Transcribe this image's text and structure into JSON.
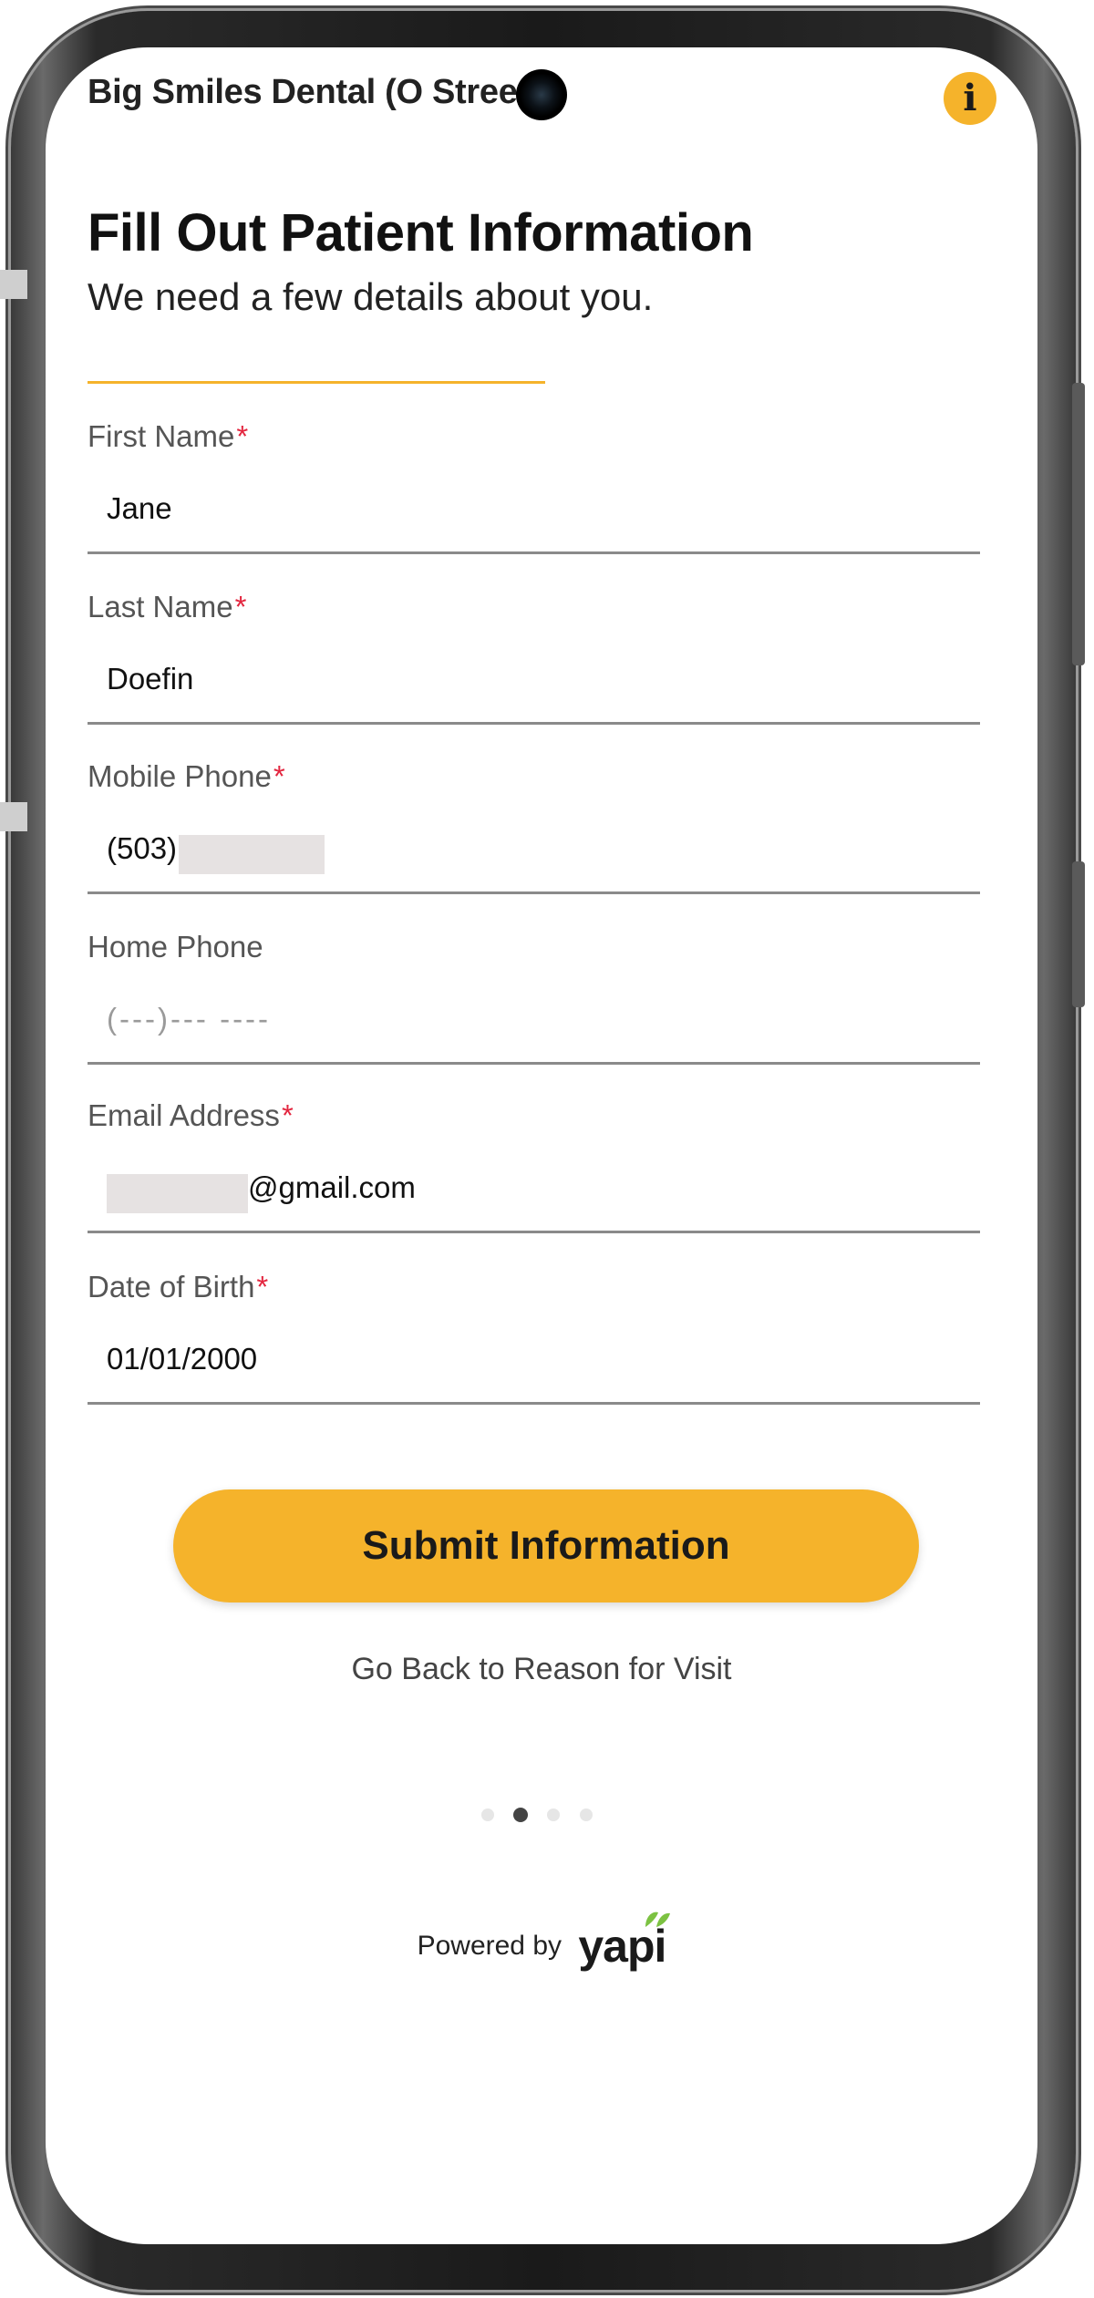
{
  "header": {
    "practice_name": "Big Smiles Dental (O Street)",
    "info_symbol": "i"
  },
  "page": {
    "title": "Fill Out Patient Information",
    "subtitle": "We need a few details about you."
  },
  "form": {
    "first_name": {
      "label": "First Name",
      "required_mark": "*",
      "value": "Jane"
    },
    "last_name": {
      "label": "Last Name",
      "required_mark": "*",
      "value": "Doefin"
    },
    "mobile_phone": {
      "label": "Mobile Phone",
      "required_mark": "*",
      "value": "(503)"
    },
    "home_phone": {
      "label": "Home Phone",
      "placeholder": "(---)--- ----",
      "value": ""
    },
    "email": {
      "label": "Email Address",
      "required_mark": "*",
      "value": "@gmail.com"
    },
    "date_of_birth": {
      "label": "Date of Birth",
      "required_mark": "*",
      "value": "01/01/2000"
    }
  },
  "actions": {
    "submit_label": "Submit Information",
    "back_label": "Go Back to Reason for Visit"
  },
  "pagination": {
    "total_steps": 4,
    "current_step": 2
  },
  "footer": {
    "powered_by": "Powered by",
    "brand": "yapi"
  },
  "colors": {
    "accent": "#f5b32b",
    "required": "#e3263f",
    "leaf_green": "#7cc242"
  },
  "icons": {
    "info": "info-icon",
    "brand_leaf": "leaf-icon",
    "camera": "camera-icon"
  }
}
